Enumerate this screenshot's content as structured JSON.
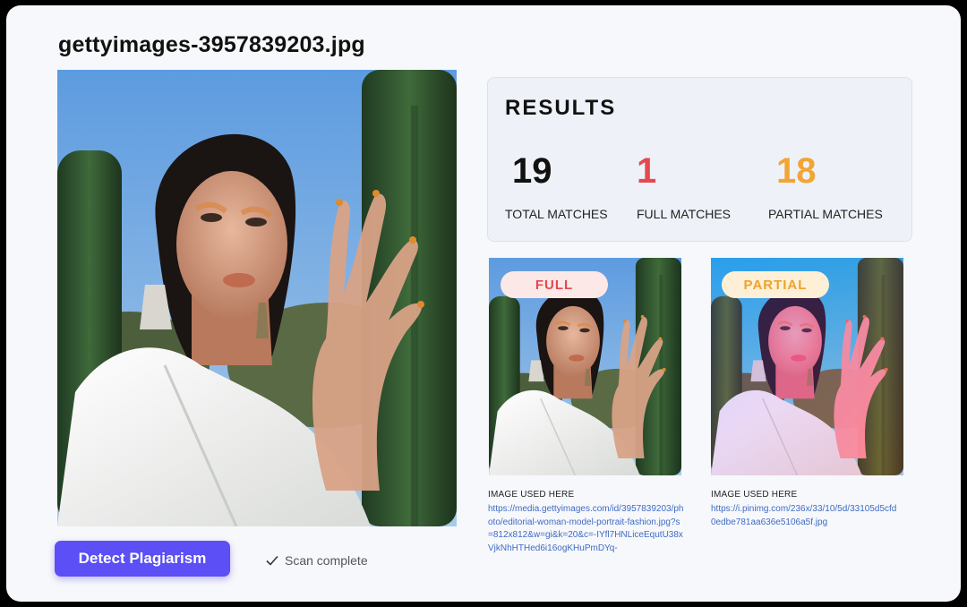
{
  "file": {
    "name": "gettyimages-3957839203.jpg"
  },
  "actions": {
    "detect_label": "Detect Plagiarism",
    "status_text": "Scan complete"
  },
  "results": {
    "heading": "RESULTS",
    "total": {
      "value": "19",
      "label": "TOTAL MATCHES"
    },
    "full": {
      "value": "1",
      "label": "FULL MATCHES"
    },
    "partial": {
      "value": "18",
      "label": "PARTIAL MATCHES"
    }
  },
  "matches": [
    {
      "badge": "FULL",
      "used_label": "IMAGE USED HERE",
      "url": "https://media.gettyimages.com/id/3957839203/photo/editorial-woman-model-portrait-fashion.jpg?s=812x812&w=gi&k=20&c=-IYfl7HNLiceEqutU38xVjkNhHTHed6i16ogKHuPmDYq-"
    },
    {
      "badge": "PARTIAL",
      "used_label": "IMAGE USED HERE",
      "url": "https://i.pinimg.com/236x/33/10/5d/33105d5cfd0edbe781aa636e5106a5f.jpg"
    }
  ],
  "colors": {
    "accent": "#5b4ff5",
    "full": "#e5484d",
    "partial": "#f2a535",
    "link": "#3f6bc4"
  },
  "icons": [
    "check-icon"
  ]
}
